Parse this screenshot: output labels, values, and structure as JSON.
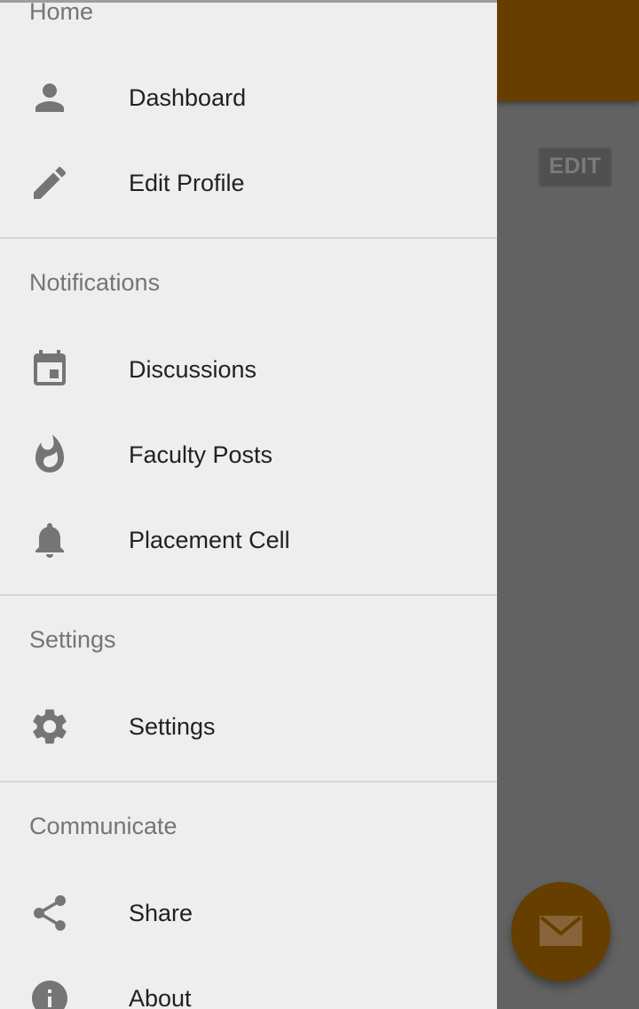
{
  "background": {
    "edit_label": "EDIT",
    "fab_icon": "mail-icon",
    "toolbar_color": "#663f00"
  },
  "drawer": {
    "sections": [
      {
        "header": "Home",
        "items": [
          {
            "label": "Dashboard",
            "icon": "person-icon"
          },
          {
            "label": "Edit Profile",
            "icon": "pencil-icon"
          }
        ]
      },
      {
        "header": "Notifications",
        "items": [
          {
            "label": "Discussions",
            "icon": "calendar-icon"
          },
          {
            "label": "Faculty Posts",
            "icon": "flame-icon"
          },
          {
            "label": "Placement Cell",
            "icon": "bell-icon"
          }
        ]
      },
      {
        "header": "Settings",
        "items": [
          {
            "label": "Settings",
            "icon": "gear-icon"
          }
        ]
      },
      {
        "header": "Communicate",
        "items": [
          {
            "label": "Share",
            "icon": "share-icon"
          },
          {
            "label": "About",
            "icon": "info-icon"
          }
        ]
      }
    ]
  }
}
